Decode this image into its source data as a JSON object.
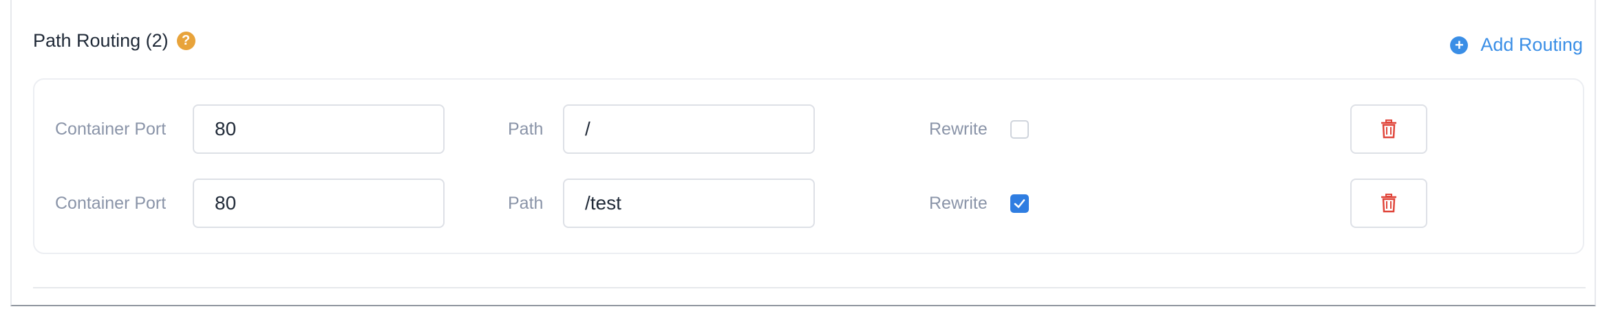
{
  "section": {
    "title": "Path Routing (2)",
    "help_icon": "question-icon",
    "help_glyph": "?",
    "add_label": "Add Routing",
    "add_icon": "plus-circle-icon",
    "add_glyph": "+"
  },
  "labels": {
    "port": "Container Port",
    "path": "Path",
    "rewrite": "Rewrite"
  },
  "routes": [
    {
      "port": "80",
      "path": "/",
      "rewrite": false
    },
    {
      "port": "80",
      "path": "/test",
      "rewrite": true
    }
  ],
  "colors": {
    "accent": "#3a8ee6",
    "help": "#e8a33a",
    "danger": "#e0453a",
    "checkbox_checked": "#2f7de1"
  }
}
